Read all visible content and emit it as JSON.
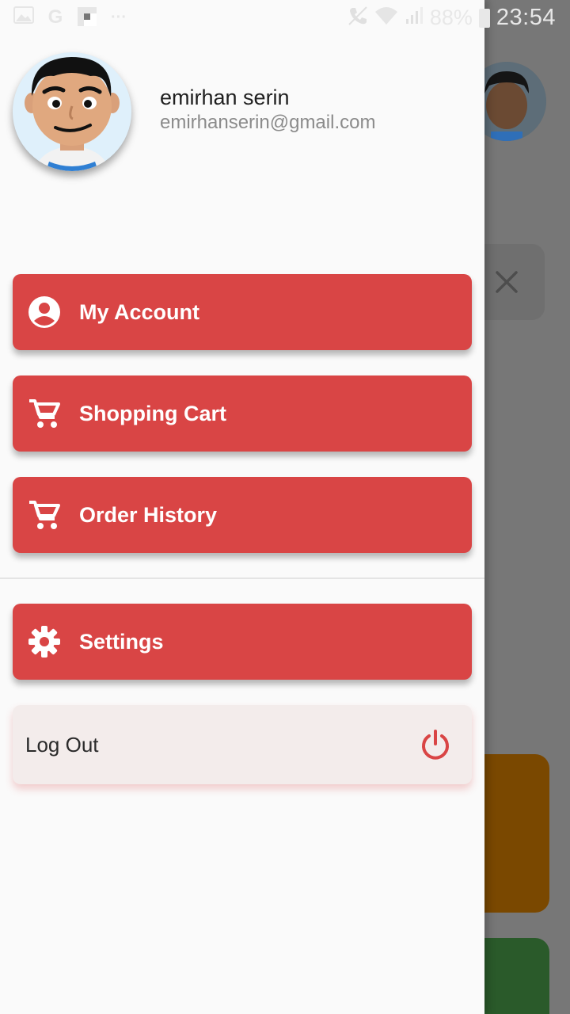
{
  "status_bar": {
    "battery": "88%",
    "time": "23:54",
    "left_icons": [
      "image-icon",
      "google-icon",
      "flipboard-icon",
      "more-dots-icon"
    ],
    "right_icons": [
      "call-icon",
      "wifi-icon",
      "signal-icon",
      "battery-icon"
    ]
  },
  "drawer": {
    "user": {
      "name": "emirhan serin",
      "email": "emirhanserin@gmail.com"
    },
    "menu": [
      {
        "label": "My Account",
        "icon": "account-circle-icon"
      },
      {
        "label": "Shopping Cart",
        "icon": "cart-icon"
      },
      {
        "label": "Order History",
        "icon": "cart-icon"
      },
      {
        "label": "Settings",
        "icon": "gear-icon"
      }
    ],
    "logout": {
      "label": "Log Out",
      "icon": "power-icon"
    }
  },
  "colors": {
    "accent": "#d94545",
    "drawer_bg": "#fafafa",
    "logout_bg": "#f3eceb",
    "scrim": "#777777"
  }
}
